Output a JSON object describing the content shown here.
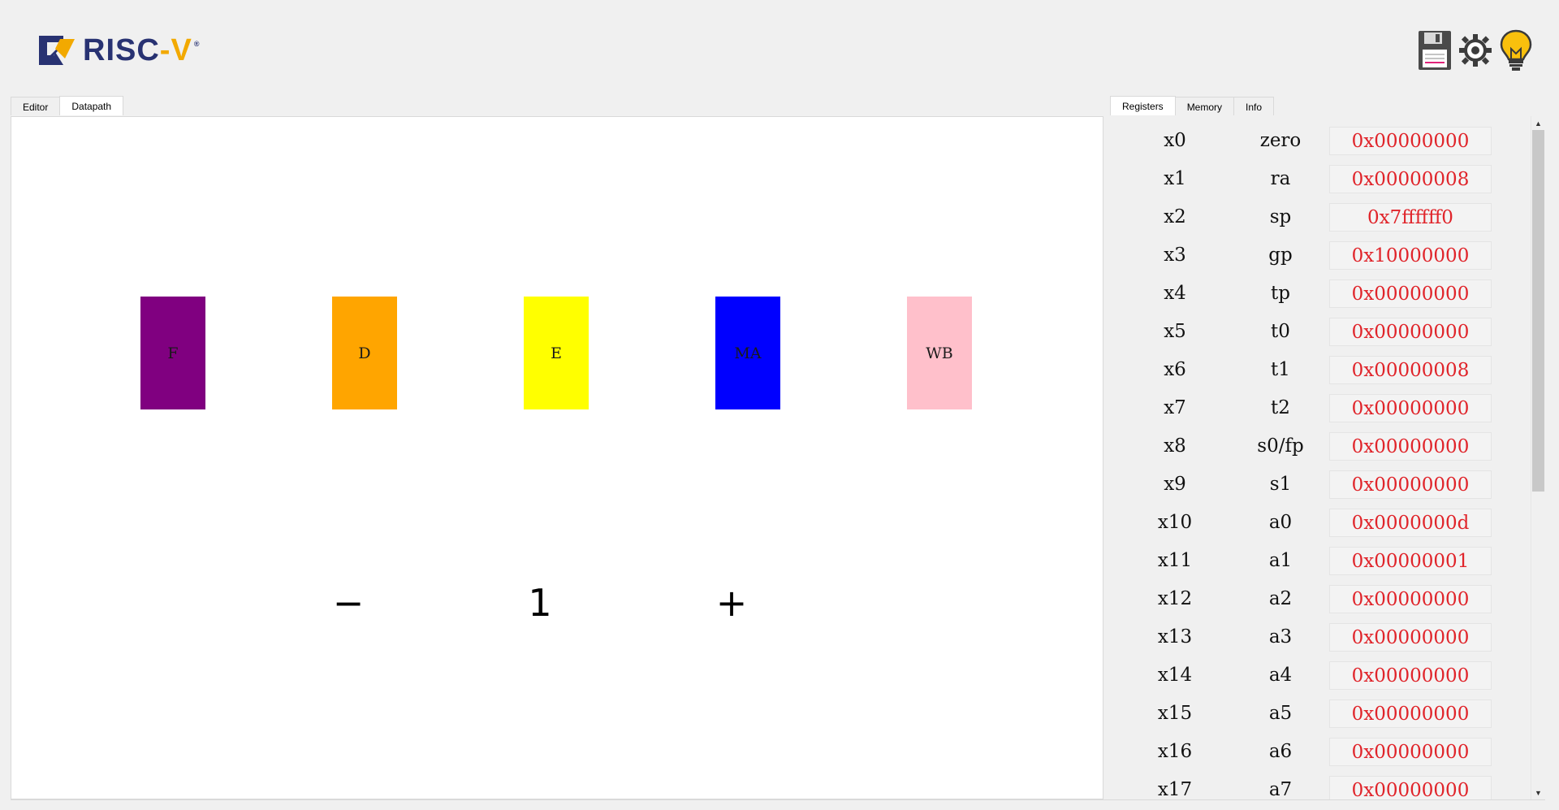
{
  "logo": {
    "text_main": "RISC",
    "text_dash": "-",
    "text_v": "V",
    "reg": "®"
  },
  "toolbar": {
    "icons": [
      "save-icon",
      "settings-icon",
      "lightbulb-icon"
    ]
  },
  "left_tabs": [
    {
      "label": "Editor",
      "active": false
    },
    {
      "label": "Datapath",
      "active": true
    }
  ],
  "right_tabs": [
    {
      "label": "Registers",
      "active": true
    },
    {
      "label": "Memory",
      "active": false
    },
    {
      "label": "Info",
      "active": false
    }
  ],
  "stages": [
    {
      "label": "F",
      "color": "#800080"
    },
    {
      "label": "D",
      "color": "#ffa500"
    },
    {
      "label": "E",
      "color": "#ffff00"
    },
    {
      "label": "MA",
      "color": "#0000ff"
    },
    {
      "label": "WB",
      "color": "#ffc0cb"
    }
  ],
  "controls": {
    "decrement": "−",
    "value": "1",
    "increment": "+"
  },
  "registers": [
    {
      "num": "x0",
      "abi": "zero",
      "value": "0x00000000"
    },
    {
      "num": "x1",
      "abi": "ra",
      "value": "0x00000008"
    },
    {
      "num": "x2",
      "abi": "sp",
      "value": "0x7ffffff0"
    },
    {
      "num": "x3",
      "abi": "gp",
      "value": "0x10000000"
    },
    {
      "num": "x4",
      "abi": "tp",
      "value": "0x00000000"
    },
    {
      "num": "x5",
      "abi": "t0",
      "value": "0x00000000"
    },
    {
      "num": "x6",
      "abi": "t1",
      "value": "0x00000008"
    },
    {
      "num": "x7",
      "abi": "t2",
      "value": "0x00000000"
    },
    {
      "num": "x8",
      "abi": "s0/fp",
      "value": "0x00000000"
    },
    {
      "num": "x9",
      "abi": "s1",
      "value": "0x00000000"
    },
    {
      "num": "x10",
      "abi": "a0",
      "value": "0x0000000d"
    },
    {
      "num": "x11",
      "abi": "a1",
      "value": "0x00000001"
    },
    {
      "num": "x12",
      "abi": "a2",
      "value": "0x00000000"
    },
    {
      "num": "x13",
      "abi": "a3",
      "value": "0x00000000"
    },
    {
      "num": "x14",
      "abi": "a4",
      "value": "0x00000000"
    },
    {
      "num": "x15",
      "abi": "a5",
      "value": "0x00000000"
    },
    {
      "num": "x16",
      "abi": "a6",
      "value": "0x00000000"
    },
    {
      "num": "x17",
      "abi": "a7",
      "value": "0x00000000"
    }
  ],
  "colors": {
    "register_value": "#e0242a",
    "logo_blue": "#283272",
    "logo_gold": "#f2a900"
  }
}
